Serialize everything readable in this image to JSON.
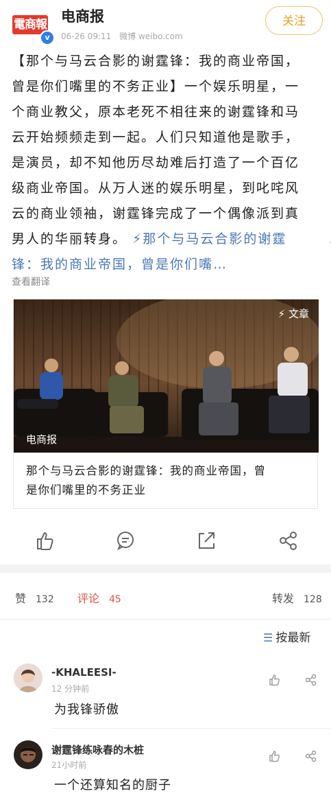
{
  "author": {
    "logo_text": "電商報",
    "name": "电商报",
    "time": "06-26 09:11",
    "source": "微博 weibo.com",
    "follow_label": "关注"
  },
  "post": {
    "line1": "【那个与马云合影的谢霆锋：我的商业帝国，",
    "line2": "曾是你们嘴里的不务正业】一个娱乐明星，一",
    "line3": "个商业教父，原本老死不相往来的谢霆锋和马",
    "line4": "云开始频频走到一起。人们只知道他是歌手，",
    "line5": "是演员，却不知他历尽劫难后打造了一个百亿",
    "line6": "级商业帝国。从万人迷的娱乐明星，到叱咤风",
    "line7": "云的商业领袖，谢霆锋完成了一个偶像派到真",
    "line8_plain": "男人的华丽转身。",
    "line8_link": "那个与马云合影的谢霆",
    "line9_link": "锋：我的商业帝国，曾是你们嘴…",
    "translate_label": "查看翻译",
    "side_arrow": "〈"
  },
  "card": {
    "tag": "文章",
    "photo_label": "电商报",
    "title_line1": "那个与马云合影的谢霆锋：我的商业帝国，曾",
    "title_line2": "是你们嘴里的不务正业"
  },
  "stats": {
    "like_label": "赞",
    "like_count": "132",
    "comment_label": "评论",
    "comment_count": "45",
    "repost_label": "转发",
    "repost_count": "128"
  },
  "sort": {
    "label": "按最新"
  },
  "comments": [
    {
      "name": "-KHALEESI-",
      "time": "12 分钟前",
      "text": "为我锋骄傲"
    },
    {
      "name": "谢霆锋练咏春的木桩",
      "time": "21小时前",
      "text": "一个还算知名的厨子"
    }
  ]
}
